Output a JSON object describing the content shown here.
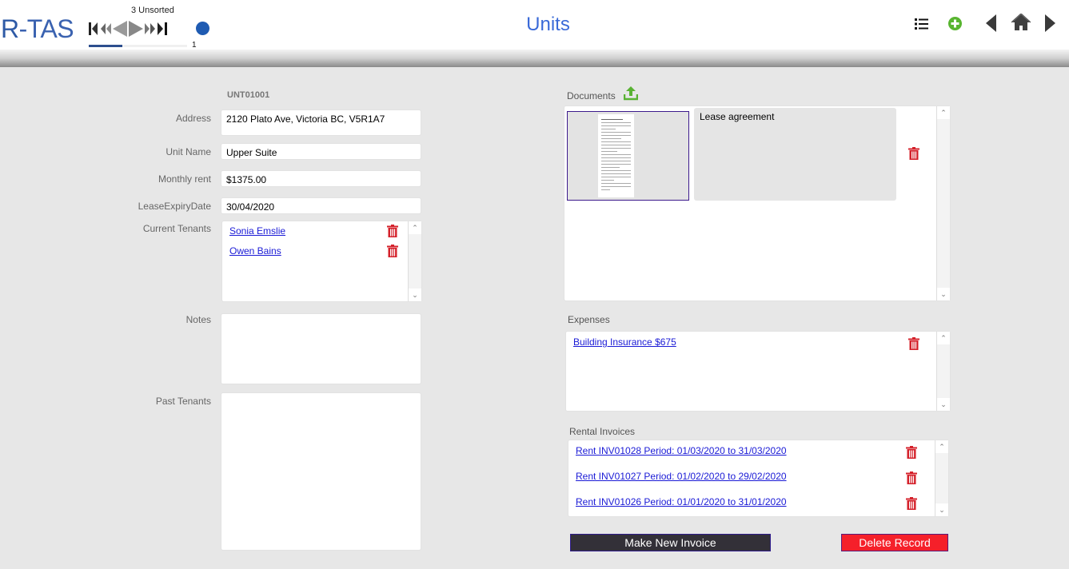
{
  "header": {
    "logo_part1": "R",
    "logo_part2": "-TAS",
    "unsorted_count": "3 Unsorted",
    "record_position": "1",
    "progress_fraction": 0.34,
    "title": "Units",
    "icons": [
      "list-icon",
      "add-circle-icon",
      "previous-layout-icon",
      "home-icon",
      "next-layout-icon"
    ],
    "nav_icons": [
      "first-record-icon",
      "previous-page-icon",
      "previous-record-icon",
      "next-record-icon",
      "next-page-icon",
      "last-record-icon",
      "status-dot-icon"
    ],
    "colors": {
      "accent": "#3a6ad8",
      "add_green": "#58b530",
      "dot_blue": "#1f5bb2"
    }
  },
  "record": {
    "id": "UNT01001",
    "fields": {
      "address_label": "Address",
      "address_value": "2120 Plato Ave, Victoria BC, V5R1A7",
      "unit_name_label": "Unit Name",
      "unit_name_value": "Upper Suite",
      "monthly_rent_label": "Monthly rent",
      "monthly_rent_value": "$1375.00",
      "lease_expiry_label": "LeaseExpiryDate",
      "lease_expiry_value": "30/04/2020",
      "current_tenants_label": "Current Tenants",
      "notes_label": "Notes",
      "notes_value": "",
      "past_tenants_label": "Past Tenants"
    },
    "current_tenants": [
      {
        "name": "Sonia Emslie"
      },
      {
        "name": "Owen Bains"
      }
    ]
  },
  "documents": {
    "label": "Documents",
    "items": [
      {
        "description": "Lease agreement"
      }
    ]
  },
  "expenses": {
    "label": "Expenses",
    "items": [
      {
        "text": "Building Insurance $675"
      }
    ]
  },
  "rental_invoices": {
    "label": "Rental Invoices",
    "items": [
      {
        "text": "Rent INV01028  Period: 01/03/2020 to 31/03/2020"
      },
      {
        "text": "Rent INV01027  Period: 01/02/2020 to 29/02/2020"
      },
      {
        "text": "Rent INV01026  Period: 01/01/2020 to 31/01/2020"
      }
    ]
  },
  "actions": {
    "make_invoice": "Make New Invoice",
    "delete_record": "Delete Record"
  },
  "scroll_symbols": {
    "up": "^",
    "down": "v"
  }
}
